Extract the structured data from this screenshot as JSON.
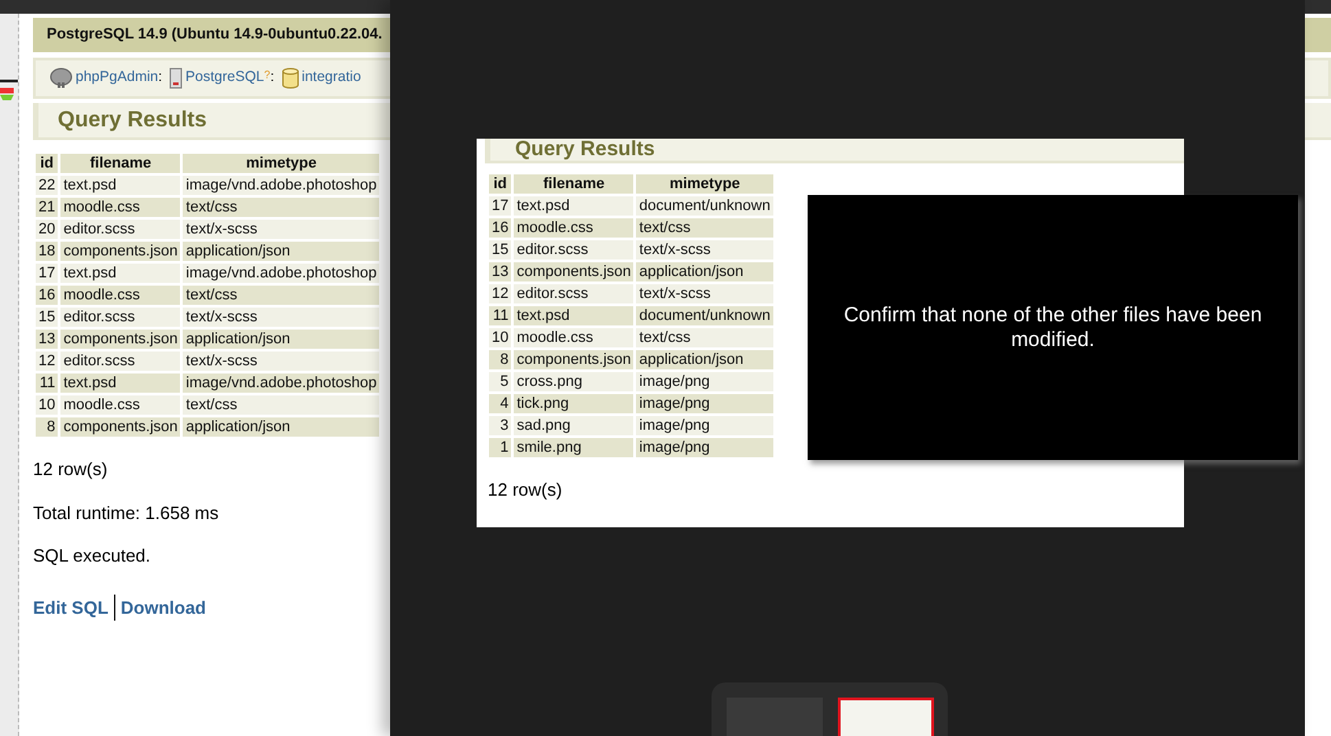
{
  "page": {
    "server_title": "PostgreSQL 14.9 (Ubuntu 14.9-0ubuntu0.22.04.",
    "breadcrumbs": [
      {
        "kind": "app",
        "label": "phpPgAdmin",
        "separator": ":"
      },
      {
        "kind": "server",
        "label": "PostgreSQL",
        "help": "?",
        "separator": ":"
      },
      {
        "kind": "database",
        "label": "integratio"
      }
    ],
    "heading": "Query Results",
    "table": {
      "columns": [
        "id",
        "filename",
        "mimetype"
      ],
      "rows": [
        [
          "22",
          "text.psd",
          "image/vnd.adobe.photoshop"
        ],
        [
          "21",
          "moodle.css",
          "text/css"
        ],
        [
          "20",
          "editor.scss",
          "text/x-scss"
        ],
        [
          "18",
          "components.json",
          "application/json"
        ],
        [
          "17",
          "text.psd",
          "image/vnd.adobe.photoshop"
        ],
        [
          "16",
          "moodle.css",
          "text/css"
        ],
        [
          "15",
          "editor.scss",
          "text/x-scss"
        ],
        [
          "13",
          "components.json",
          "application/json"
        ],
        [
          "12",
          "editor.scss",
          "text/x-scss"
        ],
        [
          "11",
          "text.psd",
          "image/vnd.adobe.photoshop"
        ],
        [
          "10",
          "moodle.css",
          "text/css"
        ],
        [
          "8",
          "components.json",
          "application/json"
        ]
      ]
    },
    "row_count": "12 row(s)",
    "runtime": "Total runtime: 1.658 ms",
    "status": "SQL executed.",
    "links": [
      "Edit SQL",
      "Download"
    ]
  },
  "viewer": {
    "slide": {
      "heading": "Query Results",
      "table": {
        "columns": [
          "id",
          "filename",
          "mimetype"
        ],
        "rows": [
          [
            "17",
            "text.psd",
            "document/unknown"
          ],
          [
            "16",
            "moodle.css",
            "text/css"
          ],
          [
            "15",
            "editor.scss",
            "text/x-scss"
          ],
          [
            "13",
            "components.json",
            "application/json"
          ],
          [
            "12",
            "editor.scss",
            "text/x-scss"
          ],
          [
            "11",
            "text.psd",
            "document/unknown"
          ],
          [
            "10",
            "moodle.css",
            "text/css"
          ],
          [
            "8",
            "components.json",
            "application/json"
          ],
          [
            "5",
            "cross.png",
            "image/png"
          ],
          [
            "4",
            "tick.png",
            "image/png"
          ],
          [
            "3",
            "sad.png",
            "image/png"
          ],
          [
            "1",
            "smile.png",
            "image/png"
          ]
        ]
      },
      "row_count": "12 row(s)"
    },
    "caption": "Confirm that none of the other files have been modified.",
    "thumbnails": [
      {
        "selected": false
      },
      {
        "selected": true
      }
    ]
  }
}
